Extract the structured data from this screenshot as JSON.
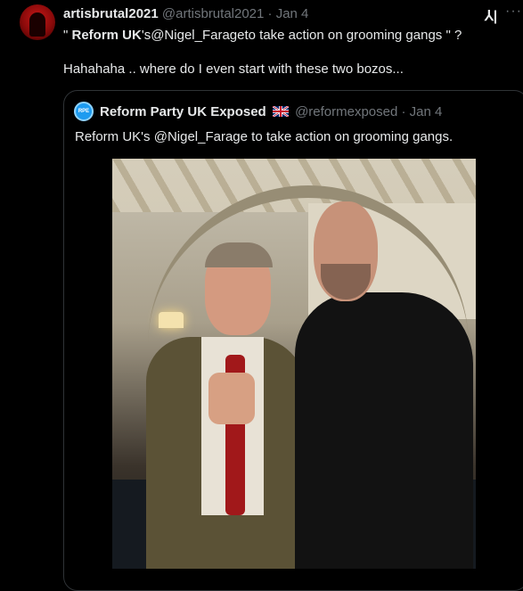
{
  "post": {
    "display_name": "artisbrutal2021",
    "handle": "@artisbrutal2021",
    "date": "· Jan 4",
    "line1_quote_open": "\" ",
    "line1_bold": "Reform UK",
    "line1_rest": "'s@Nigel_Farageto take action on grooming gangs \" ?",
    "line2": "Hahahaha .. where do I even start with these two bozos..."
  },
  "quoted": {
    "display_name": "Reform Party UK Exposed",
    "handle": "@reformexposed",
    "date": "· Jan 4",
    "text": "Reform UK's @Nigel_Farage to take action on grooming gangs."
  },
  "icons": {
    "grok": "grok-icon",
    "more": "more-icon",
    "flag": "uk-flag-icon"
  },
  "colors": {
    "background": "#000000",
    "text": "#e7e9ea",
    "secondary": "#71767b",
    "border": "#2f3336"
  }
}
